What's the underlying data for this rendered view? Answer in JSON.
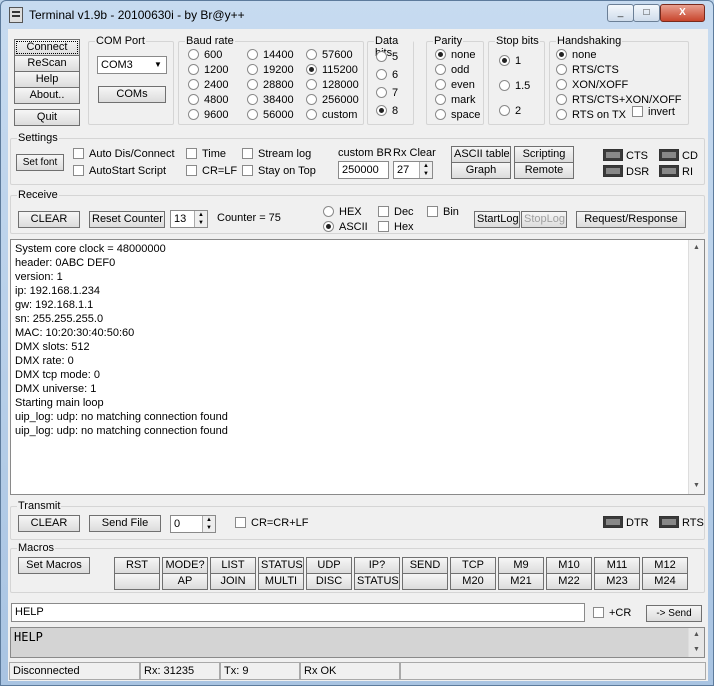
{
  "window": {
    "title": "Terminal v1.9b - 20100630i - by Br@y++",
    "min": "_",
    "max": "□",
    "close": "X"
  },
  "connection": {
    "connect": "Connect",
    "rescan": "ReScan",
    "help": "Help",
    "about": "About..",
    "quit": "Quit"
  },
  "com_port": {
    "label": "COM Port",
    "value": "COM3",
    "coms_button": "COMs"
  },
  "baud": {
    "label": "Baud rate",
    "options": [
      "600",
      "1200",
      "2400",
      "4800",
      "9600",
      "14400",
      "19200",
      "28800",
      "38400",
      "56000",
      "57600",
      "115200",
      "128000",
      "256000",
      "custom"
    ],
    "selected": "115200"
  },
  "data_bits": {
    "label": "Data bits",
    "options": [
      "5",
      "6",
      "7",
      "8"
    ],
    "selected": "8"
  },
  "parity": {
    "label": "Parity",
    "options": [
      "none",
      "odd",
      "even",
      "mark",
      "space"
    ],
    "selected": "none"
  },
  "stop_bits": {
    "label": "Stop bits",
    "options": [
      "1",
      "1.5",
      "2"
    ],
    "selected": "1"
  },
  "handshaking": {
    "label": "Handshaking",
    "options": [
      "none",
      "RTS/CTS",
      "XON/XOFF",
      "RTS/CTS+XON/XOFF",
      "RTS on TX"
    ],
    "selected": "none",
    "invert": "invert"
  },
  "settings": {
    "label": "Settings",
    "set_font": "Set font",
    "auto_dis_connect": "Auto Dis/Connect",
    "autostart_script": "AutoStart Script",
    "time": "Time",
    "cr_lf": "CR=LF",
    "stream_log": "Stream log",
    "stay_on_top": "Stay on Top",
    "custom_br_label": "custom BR",
    "custom_br_value": "250000",
    "rx_clear_label": "Rx Clear",
    "rx_clear_value": "27",
    "ascii_table": "ASCII table",
    "scripting": "Scripting",
    "graph": "Graph",
    "remote": "Remote",
    "cts": "CTS",
    "cd": "CD",
    "dsr": "DSR",
    "ri": "RI"
  },
  "receive": {
    "label": "Receive",
    "clear": "CLEAR",
    "reset_counter": "Reset Counter",
    "counter_spin": "13",
    "counter_label": "Counter = 75",
    "hex": "HEX",
    "ascii": "ASCII",
    "dec": "Dec",
    "hex2": "Hex",
    "bin": "Bin",
    "startlog": "StartLog",
    "stoplog": "StopLog",
    "request_response": "Request/Response",
    "lines": [
      "System core clock = 48000000",
      "header: 0ABC DEF0",
      "version: 1",
      "ip: 192.168.1.234",
      "gw: 192.168.1.1",
      "sn: 255.255.255.0",
      "MAC: 10:20:30:40:50:60",
      "DMX slots: 512",
      "DMX rate: 0",
      "DMX tcp mode: 0",
      "DMX universe: 1",
      "Starting main loop",
      "uip_log: udp: no matching connection found",
      "uip_log: udp: no matching connection found"
    ]
  },
  "transmit": {
    "label": "Transmit",
    "clear": "CLEAR",
    "send_file": "Send File",
    "spin_value": "0",
    "cr_crlf": "CR=CR+LF",
    "dtr": "DTR",
    "rts": "RTS"
  },
  "macros": {
    "label": "Macros",
    "set_macros": "Set Macros",
    "row1": [
      "RST",
      "MODE?",
      "LIST",
      "STATUS",
      "UDP",
      "IP?",
      "SEND",
      "TCP",
      "M9",
      "M10",
      "M11",
      "M12"
    ],
    "row2": [
      "",
      "AP",
      "JOIN",
      "MULTI",
      "DISC",
      "STATUS",
      "",
      "M20",
      "M21",
      "M22",
      "M23",
      "M24"
    ]
  },
  "send": {
    "input_value": "HELP",
    "plus_cr": "+CR",
    "send_button": "-> Send",
    "echo": "HELP"
  },
  "statusbar": {
    "state": "Disconnected",
    "rx": "Rx: 31235",
    "tx": "Tx: 9",
    "rx_ok": "Rx OK"
  }
}
